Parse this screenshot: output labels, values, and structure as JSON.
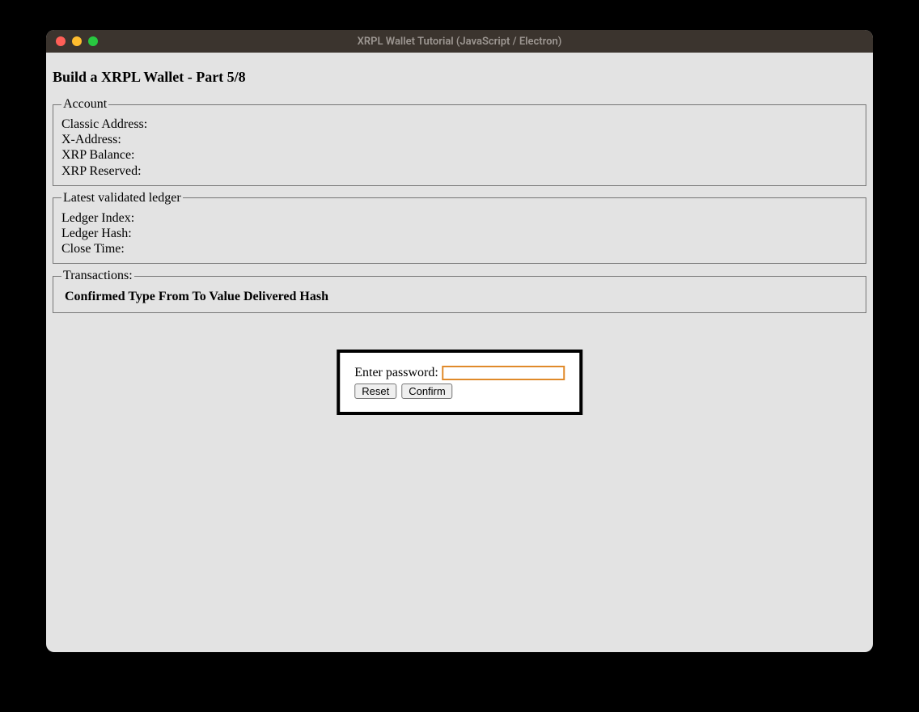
{
  "window": {
    "title": "XRPL Wallet Tutorial (JavaScript / Electron)"
  },
  "page": {
    "heading": "Build a XRPL Wallet - Part 5/8"
  },
  "account": {
    "legend": "Account",
    "classic_address_label": "Classic Address:",
    "x_address_label": "X-Address:",
    "xrp_balance_label": "XRP Balance:",
    "xrp_reserved_label": "XRP Reserved:"
  },
  "ledger": {
    "legend": "Latest validated ledger",
    "index_label": "Ledger Index:",
    "hash_label": "Ledger Hash:",
    "close_time_label": "Close Time:"
  },
  "transactions": {
    "legend": "Transactions:",
    "headers": {
      "confirmed": "Confirmed",
      "type": "Type",
      "from": "From",
      "to": "To",
      "value": "Value",
      "delivered": "Delivered",
      "hash": "Hash"
    }
  },
  "modal": {
    "password_label": "Enter password:",
    "password_value": "",
    "reset_label": "Reset",
    "confirm_label": "Confirm"
  }
}
